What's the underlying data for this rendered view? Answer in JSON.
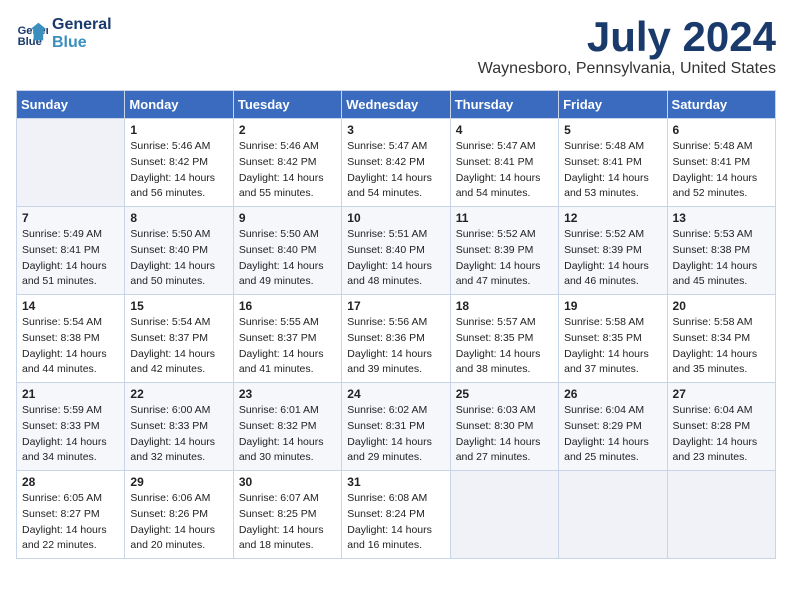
{
  "logo": {
    "line1": "General",
    "line2": "Blue"
  },
  "title": "July 2024",
  "location": "Waynesboro, Pennsylvania, United States",
  "headers": [
    "Sunday",
    "Monday",
    "Tuesday",
    "Wednesday",
    "Thursday",
    "Friday",
    "Saturday"
  ],
  "weeks": [
    [
      {
        "day": "",
        "sunrise": "",
        "sunset": "",
        "daylight": ""
      },
      {
        "day": "1",
        "sunrise": "Sunrise: 5:46 AM",
        "sunset": "Sunset: 8:42 PM",
        "daylight": "Daylight: 14 hours and 56 minutes."
      },
      {
        "day": "2",
        "sunrise": "Sunrise: 5:46 AM",
        "sunset": "Sunset: 8:42 PM",
        "daylight": "Daylight: 14 hours and 55 minutes."
      },
      {
        "day": "3",
        "sunrise": "Sunrise: 5:47 AM",
        "sunset": "Sunset: 8:42 PM",
        "daylight": "Daylight: 14 hours and 54 minutes."
      },
      {
        "day": "4",
        "sunrise": "Sunrise: 5:47 AM",
        "sunset": "Sunset: 8:41 PM",
        "daylight": "Daylight: 14 hours and 54 minutes."
      },
      {
        "day": "5",
        "sunrise": "Sunrise: 5:48 AM",
        "sunset": "Sunset: 8:41 PM",
        "daylight": "Daylight: 14 hours and 53 minutes."
      },
      {
        "day": "6",
        "sunrise": "Sunrise: 5:48 AM",
        "sunset": "Sunset: 8:41 PM",
        "daylight": "Daylight: 14 hours and 52 minutes."
      }
    ],
    [
      {
        "day": "7",
        "sunrise": "Sunrise: 5:49 AM",
        "sunset": "Sunset: 8:41 PM",
        "daylight": "Daylight: 14 hours and 51 minutes."
      },
      {
        "day": "8",
        "sunrise": "Sunrise: 5:50 AM",
        "sunset": "Sunset: 8:40 PM",
        "daylight": "Daylight: 14 hours and 50 minutes."
      },
      {
        "day": "9",
        "sunrise": "Sunrise: 5:50 AM",
        "sunset": "Sunset: 8:40 PM",
        "daylight": "Daylight: 14 hours and 49 minutes."
      },
      {
        "day": "10",
        "sunrise": "Sunrise: 5:51 AM",
        "sunset": "Sunset: 8:40 PM",
        "daylight": "Daylight: 14 hours and 48 minutes."
      },
      {
        "day": "11",
        "sunrise": "Sunrise: 5:52 AM",
        "sunset": "Sunset: 8:39 PM",
        "daylight": "Daylight: 14 hours and 47 minutes."
      },
      {
        "day": "12",
        "sunrise": "Sunrise: 5:52 AM",
        "sunset": "Sunset: 8:39 PM",
        "daylight": "Daylight: 14 hours and 46 minutes."
      },
      {
        "day": "13",
        "sunrise": "Sunrise: 5:53 AM",
        "sunset": "Sunset: 8:38 PM",
        "daylight": "Daylight: 14 hours and 45 minutes."
      }
    ],
    [
      {
        "day": "14",
        "sunrise": "Sunrise: 5:54 AM",
        "sunset": "Sunset: 8:38 PM",
        "daylight": "Daylight: 14 hours and 44 minutes."
      },
      {
        "day": "15",
        "sunrise": "Sunrise: 5:54 AM",
        "sunset": "Sunset: 8:37 PM",
        "daylight": "Daylight: 14 hours and 42 minutes."
      },
      {
        "day": "16",
        "sunrise": "Sunrise: 5:55 AM",
        "sunset": "Sunset: 8:37 PM",
        "daylight": "Daylight: 14 hours and 41 minutes."
      },
      {
        "day": "17",
        "sunrise": "Sunrise: 5:56 AM",
        "sunset": "Sunset: 8:36 PM",
        "daylight": "Daylight: 14 hours and 39 minutes."
      },
      {
        "day": "18",
        "sunrise": "Sunrise: 5:57 AM",
        "sunset": "Sunset: 8:35 PM",
        "daylight": "Daylight: 14 hours and 38 minutes."
      },
      {
        "day": "19",
        "sunrise": "Sunrise: 5:58 AM",
        "sunset": "Sunset: 8:35 PM",
        "daylight": "Daylight: 14 hours and 37 minutes."
      },
      {
        "day": "20",
        "sunrise": "Sunrise: 5:58 AM",
        "sunset": "Sunset: 8:34 PM",
        "daylight": "Daylight: 14 hours and 35 minutes."
      }
    ],
    [
      {
        "day": "21",
        "sunrise": "Sunrise: 5:59 AM",
        "sunset": "Sunset: 8:33 PM",
        "daylight": "Daylight: 14 hours and 34 minutes."
      },
      {
        "day": "22",
        "sunrise": "Sunrise: 6:00 AM",
        "sunset": "Sunset: 8:33 PM",
        "daylight": "Daylight: 14 hours and 32 minutes."
      },
      {
        "day": "23",
        "sunrise": "Sunrise: 6:01 AM",
        "sunset": "Sunset: 8:32 PM",
        "daylight": "Daylight: 14 hours and 30 minutes."
      },
      {
        "day": "24",
        "sunrise": "Sunrise: 6:02 AM",
        "sunset": "Sunset: 8:31 PM",
        "daylight": "Daylight: 14 hours and 29 minutes."
      },
      {
        "day": "25",
        "sunrise": "Sunrise: 6:03 AM",
        "sunset": "Sunset: 8:30 PM",
        "daylight": "Daylight: 14 hours and 27 minutes."
      },
      {
        "day": "26",
        "sunrise": "Sunrise: 6:04 AM",
        "sunset": "Sunset: 8:29 PM",
        "daylight": "Daylight: 14 hours and 25 minutes."
      },
      {
        "day": "27",
        "sunrise": "Sunrise: 6:04 AM",
        "sunset": "Sunset: 8:28 PM",
        "daylight": "Daylight: 14 hours and 23 minutes."
      }
    ],
    [
      {
        "day": "28",
        "sunrise": "Sunrise: 6:05 AM",
        "sunset": "Sunset: 8:27 PM",
        "daylight": "Daylight: 14 hours and 22 minutes."
      },
      {
        "day": "29",
        "sunrise": "Sunrise: 6:06 AM",
        "sunset": "Sunset: 8:26 PM",
        "daylight": "Daylight: 14 hours and 20 minutes."
      },
      {
        "day": "30",
        "sunrise": "Sunrise: 6:07 AM",
        "sunset": "Sunset: 8:25 PM",
        "daylight": "Daylight: 14 hours and 18 minutes."
      },
      {
        "day": "31",
        "sunrise": "Sunrise: 6:08 AM",
        "sunset": "Sunset: 8:24 PM",
        "daylight": "Daylight: 14 hours and 16 minutes."
      },
      {
        "day": "",
        "sunrise": "",
        "sunset": "",
        "daylight": ""
      },
      {
        "day": "",
        "sunrise": "",
        "sunset": "",
        "daylight": ""
      },
      {
        "day": "",
        "sunrise": "",
        "sunset": "",
        "daylight": ""
      }
    ]
  ]
}
